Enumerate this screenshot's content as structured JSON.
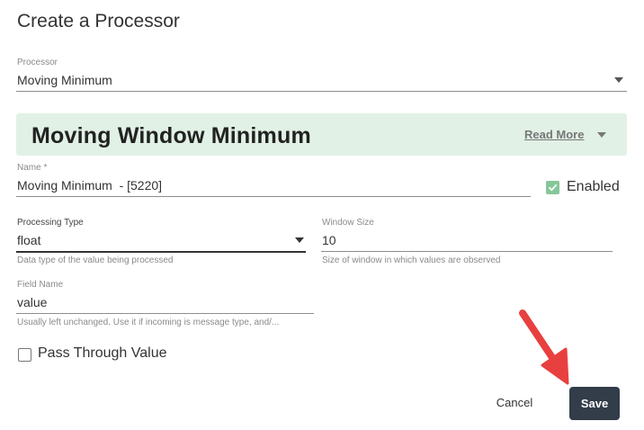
{
  "dialog": {
    "title": "Create a Processor"
  },
  "processor": {
    "label": "Processor",
    "value": "Moving Minimum"
  },
  "banner": {
    "title": "Moving Window Minimum",
    "read_more": "Read More"
  },
  "name_field": {
    "label": "Name *",
    "value": "Moving Minimum  - [5220]"
  },
  "enabled": {
    "label": "Enabled",
    "checked": true
  },
  "processing_type": {
    "label": "Processing Type",
    "value": "float",
    "helper": "Data type of the value being processed"
  },
  "window_size": {
    "label": "Window Size",
    "value": "10",
    "helper": "Size of window in which values are observed"
  },
  "field_name": {
    "label": "Field Name",
    "value": "value",
    "helper": "Usually left unchanged. Use it if incoming is message type, and/..."
  },
  "pass_through": {
    "label": "Pass Through Value",
    "checked": false
  },
  "actions": {
    "cancel": "Cancel",
    "save": "Save"
  },
  "colors": {
    "banner_bg": "#e1f1e5",
    "save_bg": "#323d49",
    "arrow": "#e8403f",
    "check": "#86c79a"
  }
}
